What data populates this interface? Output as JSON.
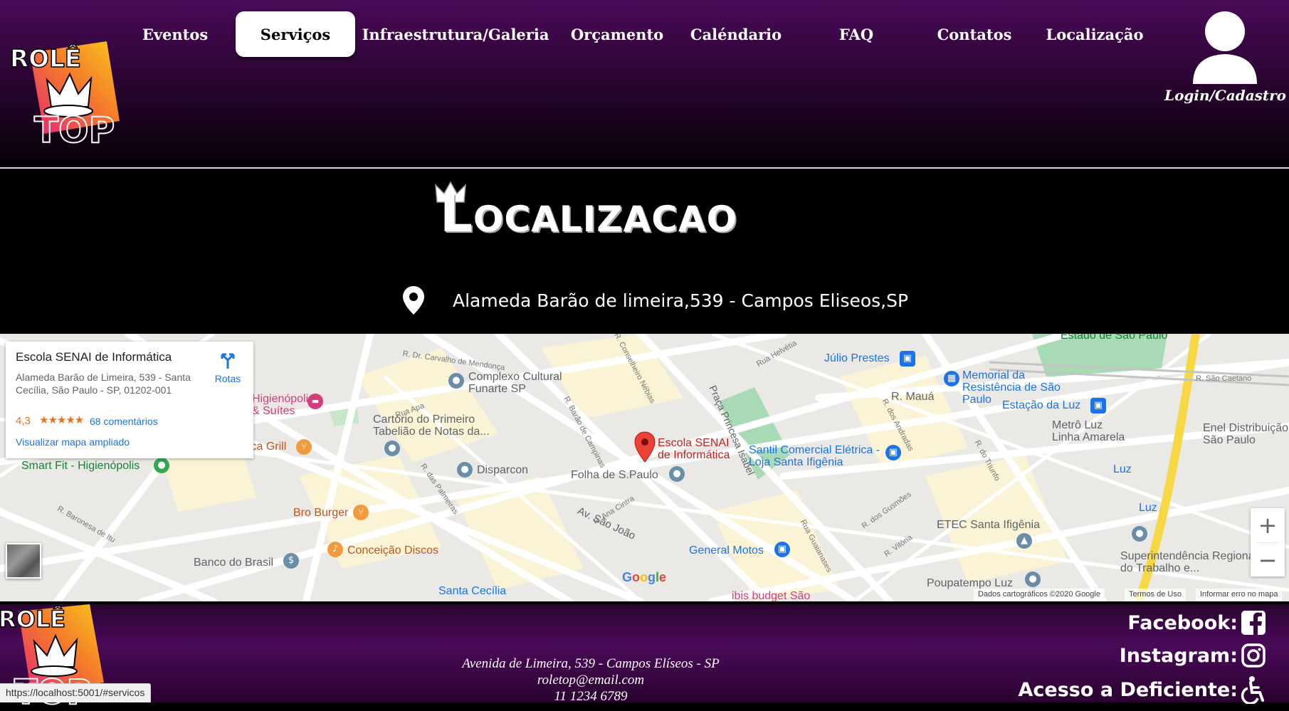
{
  "header": {
    "logo_text_top": "ROLÊ",
    "logo_text_bottom": "TOP",
    "nav": [
      {
        "label": "Eventos"
      },
      {
        "label": "Serviços"
      },
      {
        "label": "Infraestrutura/Galeria"
      },
      {
        "label": "Orçamento"
      },
      {
        "label": "Caléndario"
      },
      {
        "label": "FAQ"
      },
      {
        "label": "Contatos"
      },
      {
        "label": "Localização"
      }
    ],
    "active_nav": "Serviços",
    "login_label": "Login/Cadastro"
  },
  "location": {
    "title": "Localizacao",
    "address": "Alameda Barão de limeira,539 - Campos Eliseos,SP"
  },
  "map": {
    "card": {
      "title": "Escola SENAI de Informática",
      "address": "Alameda Barão de Limeira, 539 - Santa Cecília, São Paulo - SP, 01202-001",
      "rating": "4,3",
      "stars": "★★★★★",
      "reviews": "68 comentários",
      "link": "Visualizar mapa ampliado",
      "directions": "Rotas"
    },
    "pin_label": "Escola SENAI de Informática",
    "labels": {
      "julio_prestes": "Júlio Prestes",
      "memorial": "Memorial da Resistência de São Paulo",
      "estacao_luz": "Estação da Luz",
      "complexo": "Complexo Cultural Funarte SP",
      "cartorio": "Cartório do Primeiro Tabelião de Notas da...",
      "higienopolis": "Higienópolis & Suítes",
      "angelica": "Angelica Grill",
      "smartfit": "Smart Fit - Higienópolis",
      "disparcon": "Disparcon",
      "folha": "Folha de S.Paulo",
      "santil": "Santil Comercial Elétrica - Loja Santa Ifigênia",
      "bro_burger": "Bro Burger",
      "conceicao": "Conceição Discos",
      "banco_brasil": "Banco do Brasil",
      "general_motos": "General Motos",
      "etec": "ETEC Santa Ifigênia",
      "superintendencia": "Superintendência Regional do Trabalho e...",
      "poupatempo": "Poupatempo Luz",
      "santa_cecilia": "Santa Cecília",
      "metro_luz": "Metrô Luz Linha Amarela",
      "luz1": "Luz",
      "luz2": "Luz",
      "enel": "Enel Distribuição São Paulo",
      "estado_sp": "Estado de São Paulo",
      "ibis": "ibis budget São",
      "r_maua": "R. Mauá",
      "praca": "Praça Princesa Isabel",
      "av_sao_joao": "Av. São João"
    },
    "attribution": "Dados cartográficos ©2020 Google",
    "terms": "Termos de Uso",
    "report": "Informar erro no mapa",
    "google": "Google",
    "zoom_in": "+",
    "zoom_out": "−"
  },
  "footer": {
    "address": "Avenida de Limeira, 539 - Campos Elíseos - SP",
    "email": "roletop@email.com",
    "phone": "11 1234 6789",
    "facebook": "Facebook:",
    "instagram": "Instagram:",
    "acessibilidade": "Acesso a Deficiente:"
  },
  "status_url": "https://localhost:5001/#servicos",
  "colors": {
    "header_purple": "#4a0a58",
    "accent_pin": "#ea4335",
    "park_green": "#a8dab5"
  }
}
